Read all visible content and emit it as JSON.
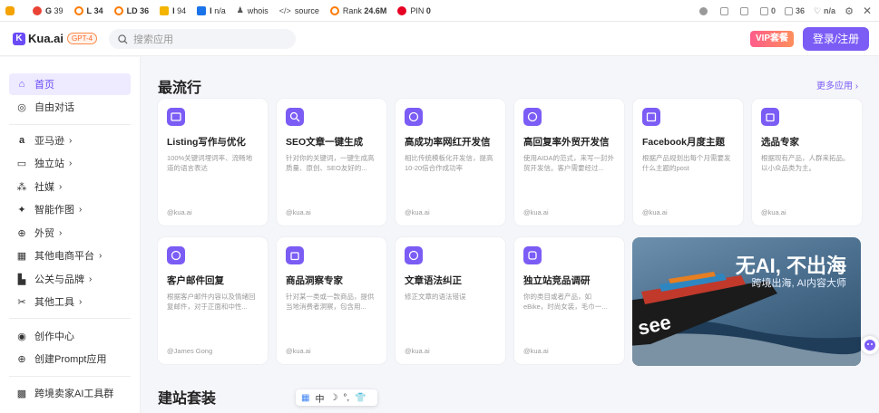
{
  "extbar": {
    "items": [
      {
        "label": "G",
        "value": "39",
        "color": "#ea4335"
      },
      {
        "label": "L",
        "value": "34",
        "color": "#ff7a00"
      },
      {
        "label": "LD",
        "value": "36",
        "color": "#ff7a00"
      },
      {
        "label": "I",
        "value": "94",
        "color": "#f4b400"
      },
      {
        "label": "I",
        "value": "n/a",
        "color": "#1a73e8"
      },
      {
        "label": "",
        "value": "whois",
        "color": "#555555"
      },
      {
        "label": "",
        "value": "source",
        "color": "#555555"
      },
      {
        "label": "Rank",
        "value": "24.6M",
        "color": "#ff7a00"
      },
      {
        "label": "PIN",
        "value": "0",
        "color": "#e60023"
      }
    ],
    "right": [
      "0",
      "36",
      "n/a"
    ]
  },
  "header": {
    "logo_text": "Kua.ai",
    "gpt_badge": "GPT-4",
    "search_placeholder": "搜索应用",
    "vip_label": "VIP套餐",
    "login_label": "登录/注册"
  },
  "sidebar": {
    "items": [
      {
        "label": "首页",
        "icon": "home-icon",
        "arrow": ""
      },
      {
        "label": "自由对话",
        "icon": "chat-icon",
        "arrow": ""
      },
      {
        "label": "亚马逊",
        "icon": "amazon-icon",
        "arrow": "›"
      },
      {
        "label": "独立站",
        "icon": "monitor-icon",
        "arrow": "›"
      },
      {
        "label": "社媒",
        "icon": "social-icon",
        "arrow": "›"
      },
      {
        "label": "智能作图",
        "icon": "image-icon",
        "arrow": "›"
      },
      {
        "label": "外贸",
        "icon": "globe-icon",
        "arrow": "›"
      },
      {
        "label": "其他电商平台",
        "icon": "grid-icon",
        "arrow": "›"
      },
      {
        "label": "公关与品牌",
        "icon": "brand-icon",
        "arrow": "›"
      },
      {
        "label": "其他工具",
        "icon": "tools-icon",
        "arrow": "›"
      },
      {
        "label": "创作中心",
        "icon": "create-icon",
        "arrow": ""
      },
      {
        "label": "创建Prompt应用",
        "icon": "plus-circle-icon",
        "arrow": ""
      },
      {
        "label": "跨境卖家AI工具群",
        "icon": "qr-icon",
        "arrow": ""
      }
    ]
  },
  "main": {
    "popular_title": "最流行",
    "more_label": "更多应用 ›",
    "site_title": "建站套装",
    "cards": [
      {
        "title": "Listing写作与优化",
        "desc": "100%关键词埋词率、流畅地道的语言表达",
        "author": "@kua.ai"
      },
      {
        "title": "SEO文章一键生成",
        "desc": "针对你的关键词，一键生成高质量、原创、SEO友好的...",
        "author": "@kua.ai"
      },
      {
        "title": "高成功率网红开发信",
        "desc": "相比传统模板化开发信，提高10-20倍合作成功率",
        "author": "@kua.ai"
      },
      {
        "title": "高回复率外贸开发信",
        "desc": "使用AIDA的范式，来写一封外贸开发信。客户需要经过...",
        "author": "@kua.ai"
      },
      {
        "title": "Facebook月度主题",
        "desc": "根据产品规划出每个月需要发什么主题的post",
        "author": "@kua.ai"
      },
      {
        "title": "选品专家",
        "desc": "根据现有产品，人群来拓品。以小众品类为主。",
        "author": "@kua.ai"
      },
      {
        "title": "客户邮件回复",
        "desc": "根据客户邮件内容以及情绪回复邮件，对于正面和中性...",
        "author": "@James Gong"
      },
      {
        "title": "商品洞察专家",
        "desc": "针对某一类或一款商品，提供当地消费者洞察，包含用...",
        "author": "@kua.ai"
      },
      {
        "title": "文章语法纠正",
        "desc": "修正文章的语法错误",
        "author": "@kua.ai"
      },
      {
        "title": "独立站竞品调研",
        "desc": "你的类目或者产品，如eBike，时尚女装，毛巾一...",
        "author": "@kua.ai"
      }
    ],
    "banner_title": "无AI, 不出海",
    "banner_sub": "跨境出海, AI内容大师"
  },
  "ime": {
    "items": [
      "中",
      "☽",
      "°,",
      "👕"
    ]
  }
}
